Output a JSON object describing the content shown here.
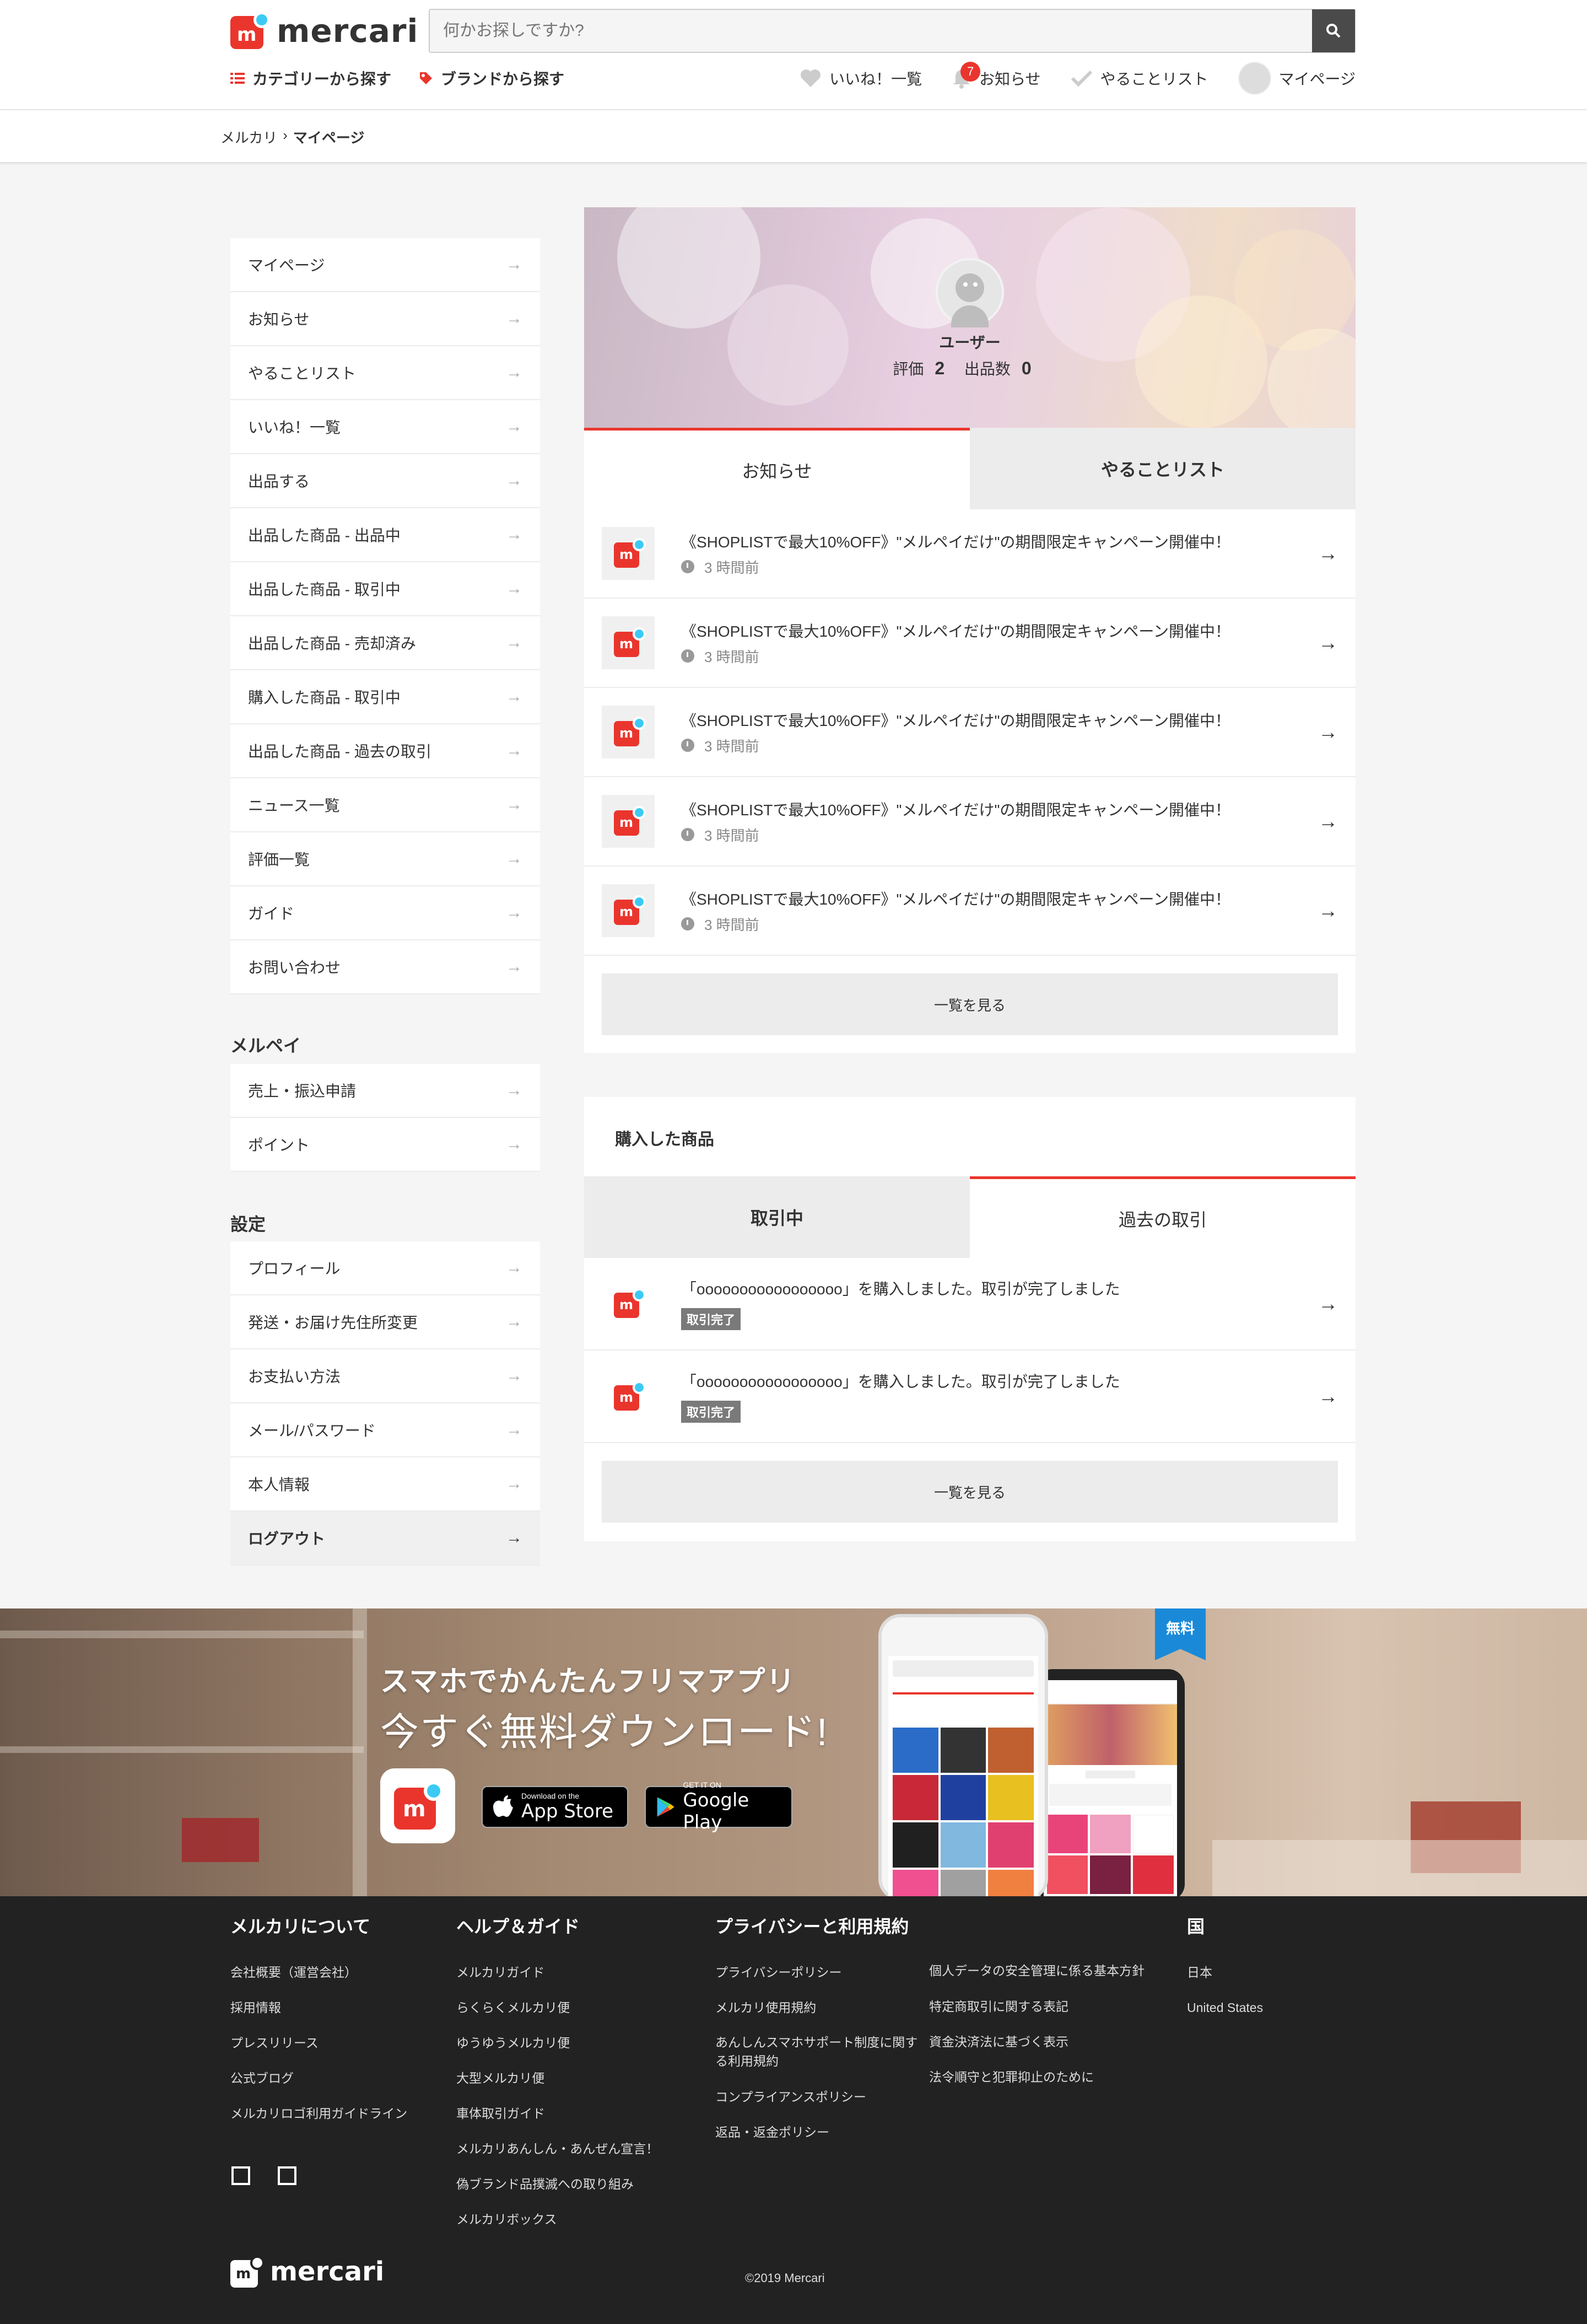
{
  "header": {
    "logo_text": "mercari",
    "search_placeholder": "何かお探しですか?",
    "category_link": "カテゴリーから探す",
    "brand_link": "ブランドから探す",
    "likes": "いいね！一覧",
    "notifications": "お知らせ",
    "notification_count": "7",
    "todo": "やることリスト",
    "mypage": "マイページ"
  },
  "breadcrumb": {
    "root": "メルカリ",
    "sep": "›",
    "current": "マイページ"
  },
  "sidebar": {
    "main_items": [
      "マイページ",
      "お知らせ",
      "やることリスト",
      "いいね！一覧",
      "出品する",
      "出品した商品 - 出品中",
      "出品した商品 - 取引中",
      "出品した商品 - 売却済み",
      "購入した商品 - 取引中",
      "出品した商品 - 過去の取引",
      "ニュース一覧",
      "評価一覧",
      "ガイド",
      "お問い合わせ"
    ],
    "merpay_heading": "メルペイ",
    "merpay_items": [
      "売上・振込申請",
      "ポイント"
    ],
    "settings_heading": "設定",
    "settings_items": [
      "プロフィール",
      "発送・お届け先住所変更",
      "お支払い方法",
      "メール/パスワード",
      "本人情報",
      "ログアウト"
    ],
    "arrow": "→"
  },
  "profile": {
    "name": "ユーザー",
    "rating_label": "評価",
    "rating": "2",
    "listings_label": "出品数",
    "listings": "0"
  },
  "notice_tabs": {
    "notice": "お知らせ",
    "todo": "やることリスト"
  },
  "notices": [
    {
      "title": "《SHOPLISTで最大10%OFF》\"メルペイだけ\"の期間限定キャンペーン開催中！",
      "time": "3 時間前"
    },
    {
      "title": "《SHOPLISTで最大10%OFF》\"メルペイだけ\"の期間限定キャンペーン開催中！",
      "time": "3 時間前"
    },
    {
      "title": "《SHOPLISTで最大10%OFF》\"メルペイだけ\"の期間限定キャンペーン開催中！",
      "time": "3 時間前"
    },
    {
      "title": "《SHOPLISTで最大10%OFF》\"メルペイだけ\"の期間限定キャンペーン開催中！",
      "time": "3 時間前"
    },
    {
      "title": "《SHOPLISTで最大10%OFF》\"メルペイだけ\"の期間限定キャンペーン開催中！",
      "time": "3 時間前"
    }
  ],
  "see_all": "一覧を見る",
  "purchased": {
    "title": "購入した商品",
    "tab_active": "取引中",
    "tab_past": "過去の取引",
    "rows": [
      {
        "title": "「ooooooooooooooooo」を購入しました。取引が完了しました",
        "tag": "取引完了"
      },
      {
        "title": "「ooooooooooooooooo」を購入しました。取引が完了しました",
        "tag": "取引完了"
      }
    ]
  },
  "promo": {
    "line1": "スマホでかんたんフリマアプリ",
    "line2": "今すぐ無料ダウンロード!",
    "appstore_small": "Download on the",
    "appstore_large": "App Store",
    "gplay_small": "GET IT ON",
    "gplay_large": "Google Play",
    "free": "無料"
  },
  "footer": {
    "about_heading": "メルカリについて",
    "about": [
      "会社概要（運営会社）",
      "採用情報",
      "プレスリリース",
      "公式ブログ",
      "メルカリロゴ利用ガイドライン"
    ],
    "help_heading": "ヘルプ＆ガイド",
    "help": [
      "メルカリガイド",
      "らくらくメルカリ便",
      "ゆうゆうメルカリ便",
      "大型メルカリ便",
      "車体取引ガイド",
      "メルカリあんしん・あんぜん宣言！",
      "偽ブランド品撲滅への取り組み",
      "メルカリボックス"
    ],
    "privacy_heading": "プライバシーと利用規約",
    "privacy1": [
      "プライバシーポリシー",
      "メルカリ使用規約",
      "あんしんスマホサポート制度に関する利用規約",
      "コンプライアンスポリシー",
      "返品・返金ポリシー"
    ],
    "privacy2": [
      "個人データの安全管理に係る基本方針",
      "特定商取引に関する表記",
      "資金決済法に基づく表示",
      "法令順守と犯罪抑止のために"
    ],
    "country_heading": "国",
    "countries": [
      "日本",
      "United States"
    ],
    "logo_text": "mercari",
    "copyright": "©2019 Mercari"
  },
  "colors": {
    "brand_red": "#ea352d",
    "brand_blue": "#3ccaf4",
    "footer_bg": "#222222"
  }
}
